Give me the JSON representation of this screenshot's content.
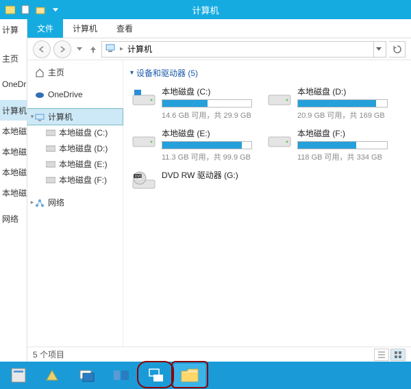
{
  "window": {
    "title": "计算机"
  },
  "ribbon": {
    "file": "文件",
    "tabs": [
      "计算机",
      "查看"
    ]
  },
  "left_edge": {
    "items": [
      "计算",
      "",
      "主页",
      "",
      "OneDrive",
      "",
      "计算机",
      "本地磁",
      "本地磁",
      "本地磁",
      "本地磁",
      "",
      "网络"
    ]
  },
  "address": {
    "root": "计算机",
    "chevron": "▸"
  },
  "tree": {
    "home": "主页",
    "onedrive": "OneDrive",
    "computer": "计算机",
    "drives": [
      "本地磁盘 (C:)",
      "本地磁盘 (D:)",
      "本地磁盘 (E:)",
      "本地磁盘 (F:)"
    ],
    "network": "网络"
  },
  "content": {
    "group_header": "设备和驱动器 (5)",
    "drives": [
      {
        "name": "本地磁盘 (C:)",
        "stats": "14.6 GB 可用，共 29.9 GB",
        "fill": 51
      },
      {
        "name": "本地磁盘 (D:)",
        "stats": "20.9 GB 可用，共 169 GB",
        "fill": 88
      },
      {
        "name": "本地磁盘 (E:)",
        "stats": "11.3 GB 可用，共 99.9 GB",
        "fill": 89
      },
      {
        "name": "本地磁盘 (F:)",
        "stats": "118 GB 可用，共 334 GB",
        "fill": 65
      }
    ],
    "dvd": {
      "name": "DVD RW 驱动器 (G:)"
    }
  },
  "status": {
    "text": "5 个项目"
  }
}
